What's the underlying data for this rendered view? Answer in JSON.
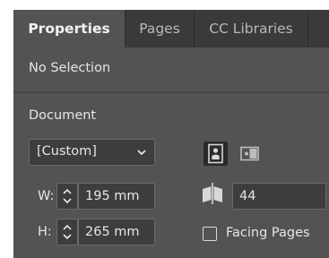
{
  "tabs": [
    {
      "label": "Properties",
      "active": true
    },
    {
      "label": "Pages",
      "active": false
    },
    {
      "label": "CC Libraries",
      "active": false
    }
  ],
  "selection_status": "No Selection",
  "document": {
    "section_title": "Document",
    "preset": "[Custom]",
    "orientation": "portrait",
    "width_label": "W:",
    "width_value": "195 mm",
    "height_label": "H:",
    "height_value": "265 mm",
    "pages_count": "44",
    "facing_pages_label": "Facing Pages",
    "facing_pages_checked": false
  },
  "colors": {
    "panel_bg": "#535353",
    "tabbar_bg": "#3a3a3a",
    "field_bg": "#3d3d3d"
  }
}
